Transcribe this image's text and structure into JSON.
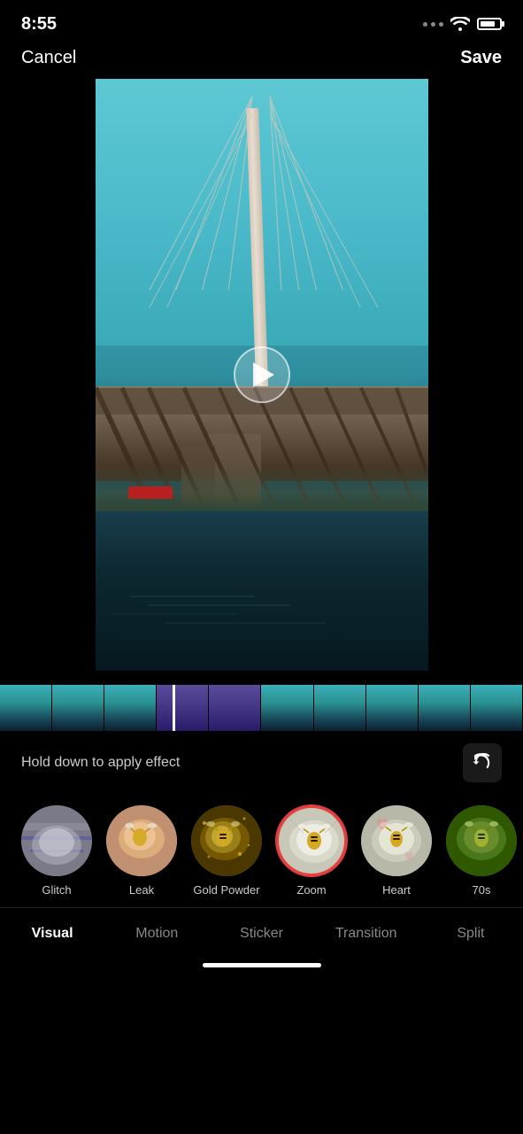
{
  "statusBar": {
    "time": "8:55"
  },
  "header": {
    "cancel": "Cancel",
    "save": "Save"
  },
  "video": {
    "playLabel": "Play"
  },
  "holdText": "Hold down to apply effect",
  "effects": [
    {
      "id": "glitch",
      "label": "Glitch",
      "selected": false,
      "thumbClass": "thumb-glitch"
    },
    {
      "id": "leak",
      "label": "Leak",
      "selected": false,
      "thumbClass": "thumb-leak"
    },
    {
      "id": "gold-powder",
      "label": "Gold Powder",
      "selected": false,
      "thumbClass": "thumb-gold"
    },
    {
      "id": "zoom",
      "label": "Zoom",
      "selected": true,
      "thumbClass": "thumb-zoom"
    },
    {
      "id": "heart",
      "label": "Heart",
      "selected": false,
      "thumbClass": "thumb-heart"
    },
    {
      "id": "70s",
      "label": "70s",
      "selected": false,
      "thumbClass": "thumb-70s"
    }
  ],
  "tabs": [
    {
      "id": "visual",
      "label": "Visual",
      "active": true
    },
    {
      "id": "motion",
      "label": "Motion",
      "active": false
    },
    {
      "id": "sticker",
      "label": "Sticker",
      "active": false
    },
    {
      "id": "transition",
      "label": "Transition",
      "active": false
    },
    {
      "id": "split",
      "label": "Split",
      "active": false
    }
  ],
  "undo": "↩"
}
